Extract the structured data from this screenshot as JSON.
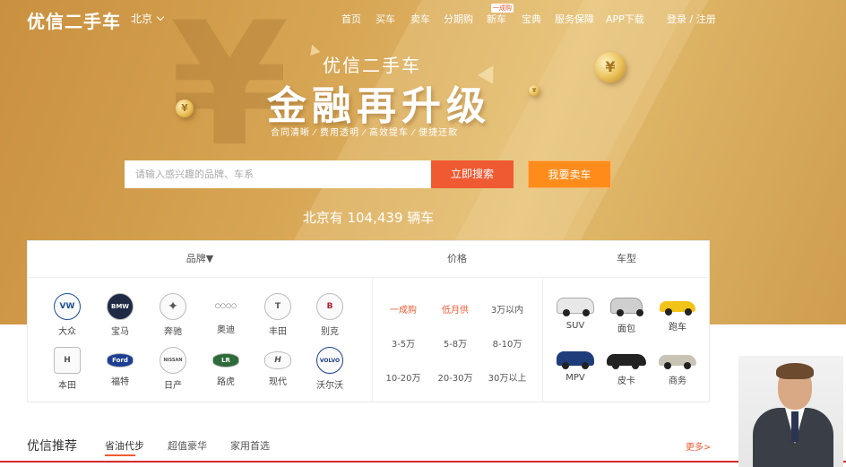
{
  "header": {
    "logo": "优信二手车",
    "city": "北京",
    "nav": [
      {
        "label": "首页"
      },
      {
        "label": "买车"
      },
      {
        "label": "卖车"
      },
      {
        "label": "分期购"
      },
      {
        "label": "新车",
        "badge": "一成购"
      },
      {
        "label": "宝典"
      },
      {
        "label": "服务保障"
      },
      {
        "label": "APP下载"
      }
    ],
    "login": "登录 / 注册"
  },
  "hero": {
    "subtitle": "优信二手车",
    "title": "金融再升级",
    "tags": "合同清晰 ⁄ 费用透明 ⁄ 高效提车 ⁄ 便捷还款"
  },
  "search": {
    "placeholder": "请输入感兴趣的品牌、车系",
    "search_button": "立即搜索",
    "sell_button": "我要卖车",
    "count_text": "北京有 104,439 辆车"
  },
  "filters": {
    "brand_header": "品牌▼",
    "price_header": "价格",
    "type_header": "车型",
    "brands": [
      {
        "name": "大众",
        "logo": "VW"
      },
      {
        "name": "宝马",
        "logo": "BMW"
      },
      {
        "name": "奔驰",
        "logo": "✦"
      },
      {
        "name": "奥迪",
        "logo": "○○○○"
      },
      {
        "name": "丰田",
        "logo": "T"
      },
      {
        "name": "别克",
        "logo": "B"
      },
      {
        "name": "本田",
        "logo": "H"
      },
      {
        "name": "福特",
        "logo": "Ford"
      },
      {
        "name": "日产",
        "logo": "NISSAN"
      },
      {
        "name": "路虎",
        "logo": "LR"
      },
      {
        "name": "现代",
        "logo": "H"
      },
      {
        "name": "沃尔沃",
        "logo": "VOLVO"
      }
    ],
    "prices": [
      "一成购",
      "低月供",
      "3万以内",
      "3-5万",
      "5-8万",
      "8-10万",
      "10-20万",
      "20-30万",
      "30万以上"
    ],
    "types": [
      {
        "name": "SUV",
        "color": "#e8e8e8"
      },
      {
        "name": "面包",
        "color": "#cfcfcf"
      },
      {
        "name": "跑车",
        "color": "#f2c318"
      },
      {
        "name": "MPV",
        "color": "#1f3d7a"
      },
      {
        "name": "皮卡",
        "color": "#222222"
      },
      {
        "name": "商务",
        "color": "#c9c3b6"
      }
    ]
  },
  "recommend": {
    "title": "优信推荐",
    "tabs": [
      "省油代步",
      "超值豪华",
      "家用首选"
    ],
    "more": "更多>"
  },
  "colors": {
    "accent": "#f05a32",
    "sell": "#ff8c1a",
    "hero": "#d6a553"
  }
}
